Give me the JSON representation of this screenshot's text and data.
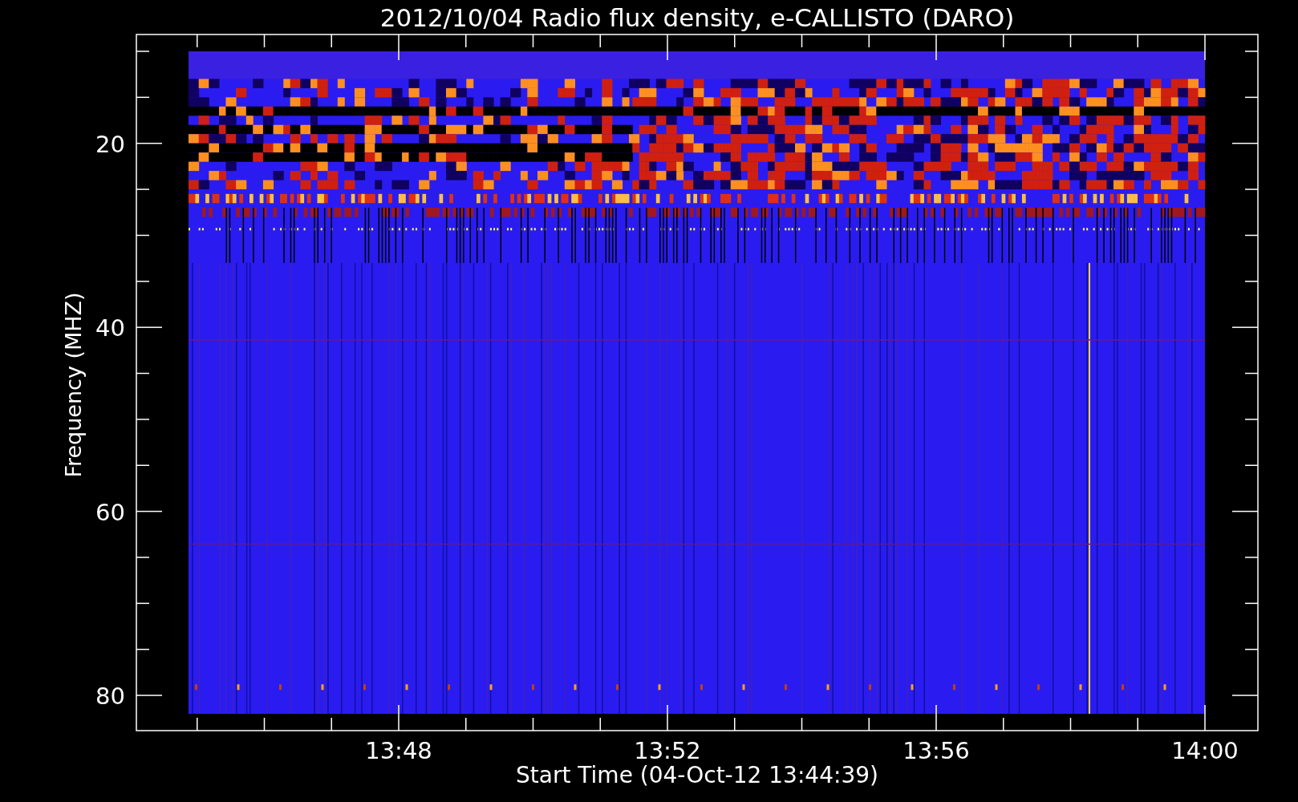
{
  "title": "2012/10/04  Radio flux density, e-CALLISTO (DARO)",
  "y_axis": {
    "label": "Frequency (MHZ)",
    "ticks": [
      "20",
      "40",
      "60",
      "80"
    ]
  },
  "x_axis": {
    "label": "Start Time (04-Oct-12 13:44:39)",
    "ticks": [
      "13:48",
      "13:52",
      "13:56",
      "14:00"
    ]
  }
}
